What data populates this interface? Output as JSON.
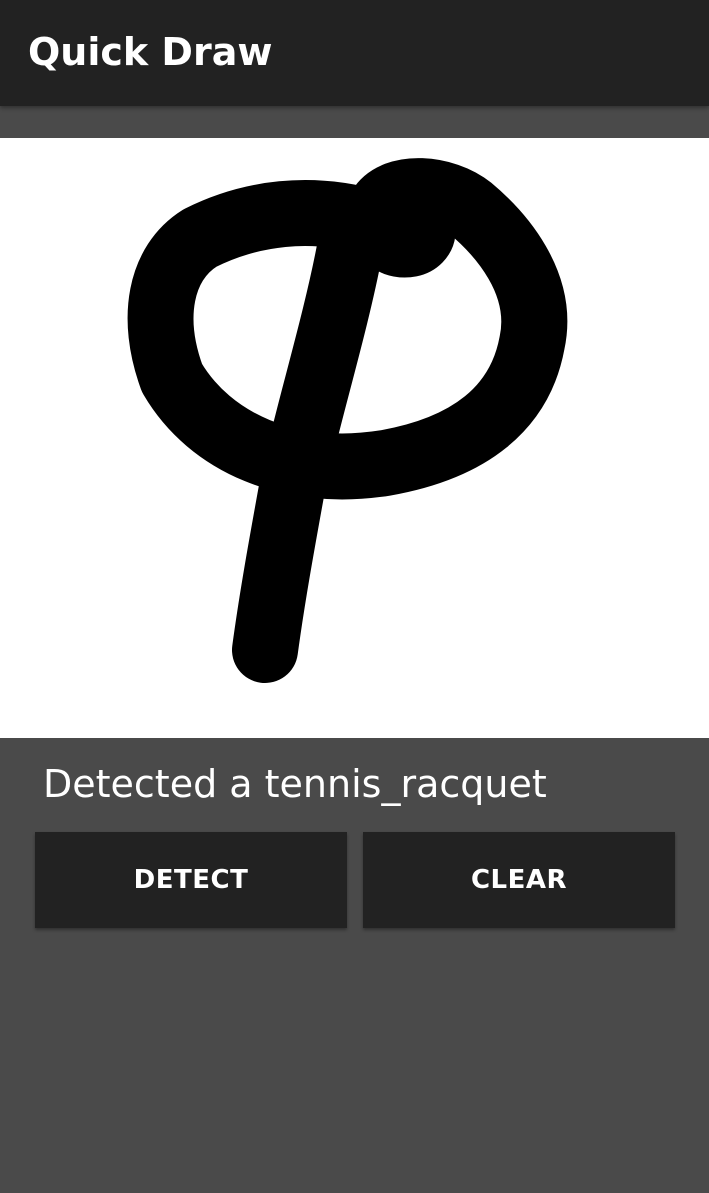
{
  "app_bar": {
    "title": "Quick Draw"
  },
  "result": {
    "text": "Detected a tennis_racquet"
  },
  "buttons": {
    "detect_label": "DETECT",
    "clear_label": "CLEAR"
  },
  "colors": {
    "app_bar": "#222222",
    "background": "#4a4a4a",
    "canvas": "#ffffff",
    "stroke": "#000000",
    "text": "#ffffff"
  }
}
